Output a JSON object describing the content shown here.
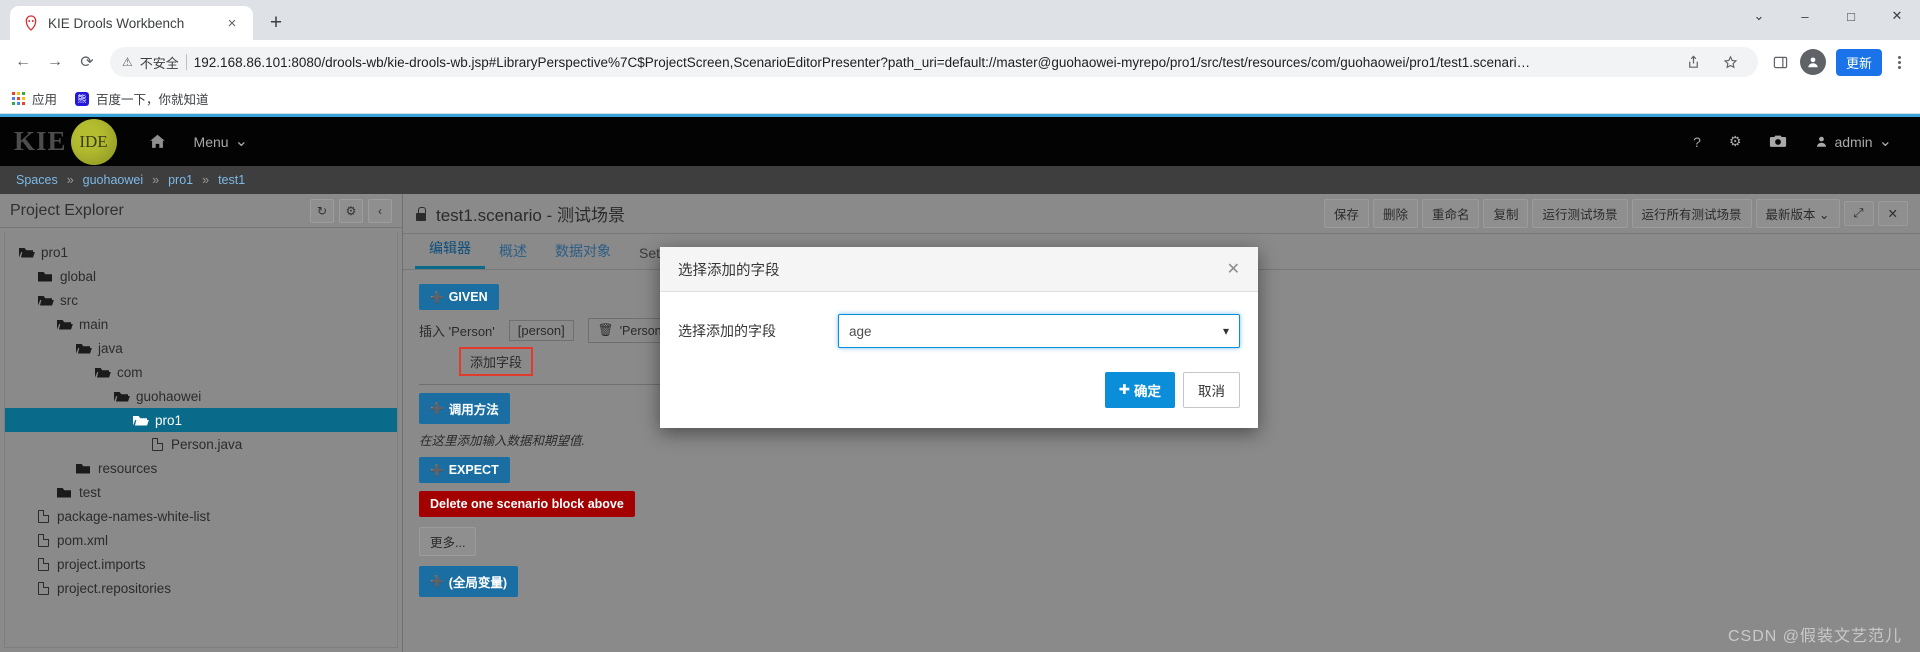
{
  "browser": {
    "tab": {
      "title": "KIE Drools Workbench",
      "favicon": "drools-icon",
      "close": "×"
    },
    "newtab_label": "+",
    "window_controls": {
      "minimize": "–",
      "maximize": "□",
      "close": "✕",
      "chevron": "⌄"
    },
    "nav": {
      "back": "←",
      "forward": "→",
      "reload": "⟳"
    },
    "omnibox": {
      "warning_icon": "warning-triangle-icon",
      "security_text": "不安全",
      "url": "192.168.86.101:8080/drools-wb/kie-drools-wb.jsp#LibraryPerspective%7C$ProjectScreen,ScenarioEditorPresenter?path_uri=default://master@guohaowei-myrepo/pro1/src/test/resources/com/guohaowei/pro1/test1.scenari…",
      "share_icon": "share-icon",
      "star_icon": "bookmark-star-icon",
      "sidepanel_icon": "side-panel-icon",
      "profile_initial": "👤",
      "update_label": "更新",
      "menu_icon": "kebab-menu-icon"
    },
    "bookmarks": [
      {
        "icon": "apps-grid-icon",
        "label": "应用"
      },
      {
        "icon": "baidu-icon",
        "label": "百度一下，你就知道"
      }
    ]
  },
  "app_header": {
    "logo_text": "KIE",
    "badge_text": "IDE",
    "home_icon": "home-icon",
    "menu_label": "Menu",
    "menu_caret": "⌄",
    "right_icons": [
      {
        "name": "help-icon",
        "glyph": "?"
      },
      {
        "name": "gear-icon",
        "glyph": "⚙"
      },
      {
        "name": "camera-icon",
        "glyph": "📷"
      }
    ],
    "user_label": "admin",
    "user_icon": "user-icon",
    "user_caret": "⌄"
  },
  "breadcrumb": {
    "items": [
      "Spaces",
      "guohaowei",
      "pro1",
      "test1"
    ],
    "separator": "»"
  },
  "sidebar": {
    "title": "Project Explorer",
    "buttons": [
      {
        "name": "refresh-button",
        "glyph": "↻"
      },
      {
        "name": "settings-button",
        "glyph": "⚙"
      },
      {
        "name": "collapse-button",
        "glyph": "‹"
      }
    ],
    "tree": [
      {
        "label": "pro1",
        "type": "folder-open",
        "indent": 0,
        "selected": false
      },
      {
        "label": "global",
        "type": "folder",
        "indent": 1,
        "selected": false
      },
      {
        "label": "src",
        "type": "folder-open",
        "indent": 1,
        "selected": false
      },
      {
        "label": "main",
        "type": "folder-open",
        "indent": 2,
        "selected": false
      },
      {
        "label": "java",
        "type": "folder-open",
        "indent": 3,
        "selected": false
      },
      {
        "label": "com",
        "type": "folder-open",
        "indent": 4,
        "selected": false
      },
      {
        "label": "guohaowei",
        "type": "folder-open",
        "indent": 5,
        "selected": false
      },
      {
        "label": "pro1",
        "type": "folder-open",
        "indent": 6,
        "selected": true
      },
      {
        "label": "Person.java",
        "type": "file",
        "indent": 7,
        "selected": false
      },
      {
        "label": "resources",
        "type": "folder",
        "indent": 3,
        "selected": false
      },
      {
        "label": "test",
        "type": "folder",
        "indent": 2,
        "selected": false
      },
      {
        "label": "package-names-white-list",
        "type": "file",
        "indent": 1,
        "selected": false
      },
      {
        "label": "pom.xml",
        "type": "file",
        "indent": 1,
        "selected": false
      },
      {
        "label": "project.imports",
        "type": "file",
        "indent": 1,
        "selected": false
      },
      {
        "label": "project.repositories",
        "type": "file",
        "indent": 1,
        "selected": false
      }
    ]
  },
  "editor": {
    "lock_icon": "lock-icon",
    "title": "test1.scenario - 测试场景",
    "actions": [
      "保存",
      "删除",
      "重命名",
      "复制",
      "运行测试场景",
      "运行所有测试场景"
    ],
    "version_label": "最新版本",
    "version_caret": "⌄",
    "expand_icon": "expand-icon",
    "close_icon": "close-icon",
    "tabs": [
      {
        "label": "编辑器",
        "active": true
      },
      {
        "label": "概述",
        "active": false
      },
      {
        "label": "数据对象",
        "active": false
      },
      {
        "label": "Setti",
        "active": false
      }
    ],
    "given_button": "GIVEN",
    "given_plus": "➕",
    "insert_text": "插入 'Person'",
    "person_tag": "[person]",
    "fact_box": "'Person' facts",
    "fact_trash_icon": "trash-icon",
    "add_field_button": "添加字段",
    "call_method_button": "调用方法",
    "hint_text": "在这里添加输入数据和期望值.",
    "expect_button": "EXPECT",
    "delete_block_button": "Delete one scenario block above",
    "more_button": "更多...",
    "global_var_button": "(全局变量)"
  },
  "modal": {
    "title": "选择添加的字段",
    "close_glyph": "✕",
    "field_label": "选择添加的字段",
    "select_value": "age",
    "select_caret": "⌄",
    "ok_button": "确定",
    "ok_plus": "✚",
    "cancel_button": "取消",
    "accent_color": "#0a8ed9"
  },
  "watermark": "CSDN @假装文艺范儿"
}
